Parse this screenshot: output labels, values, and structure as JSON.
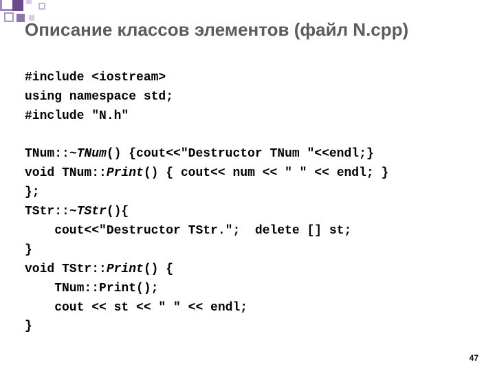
{
  "title": "Описание классов элементов (файл N.cpp)",
  "code": {
    "l01a": "#include ",
    "l01b": "<iostream>",
    "l02": "using namespace std;",
    "l03": "#include \"N.h\"",
    "l04": "",
    "l05a": "TNum::",
    "l05b": "~TNum",
    "l05c": "() {cout<<\"Destructor TNum \"<<endl;}",
    "l06a": "void TNum::",
    "l06b": "Print",
    "l06c": "() { cout<< num << \" \" << endl; }",
    "l07": "};",
    "l08a": "TStr::",
    "l08b": "~TStr",
    "l08c": "(){",
    "l09": "    cout<<\"Destructor TStr.\";  delete [] st;",
    "l10": "}",
    "l11a": "void TStr::",
    "l11b": "Print",
    "l11c": "() {",
    "l12": "    TNum::Print();",
    "l13": "    cout << st << \" \" << endl;",
    "l14": "}"
  },
  "page_number": "47"
}
